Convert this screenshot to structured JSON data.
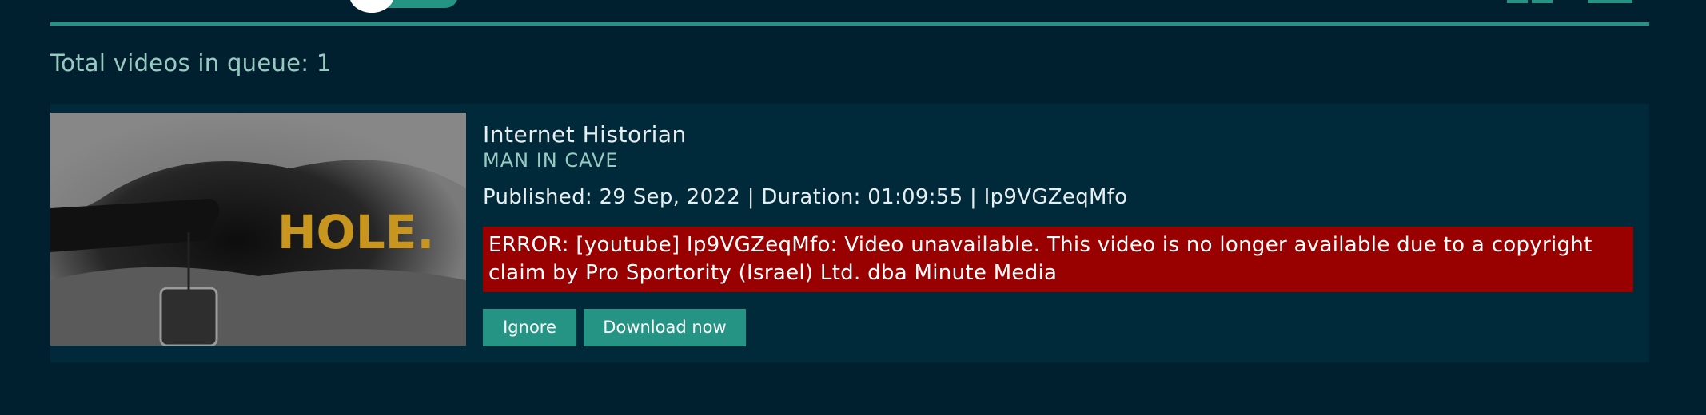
{
  "queue": {
    "total_label": "Total videos in queue: 1"
  },
  "video": {
    "thumbnail_text": "HOLE.",
    "channel": "Internet Historian",
    "title": "MAN IN CAVE",
    "meta": "Published: 29 Sep, 2022 | Duration: 01:09:55 | Ip9VGZeqMfo",
    "error": "ERROR: [youtube] Ip9VGZeqMfo: Video unavailable. This video is no longer available due to a copyright claim by Pro Sportority (Israel) Ltd. dba Minute Media"
  },
  "actions": {
    "ignore_label": "Ignore",
    "download_label": "Download now"
  },
  "colors": {
    "background": "#00202f",
    "card": "#00293a",
    "accent": "#259485",
    "title_text": "#97cbc2",
    "error": "#990000",
    "thumb_text": "#c8961e"
  }
}
